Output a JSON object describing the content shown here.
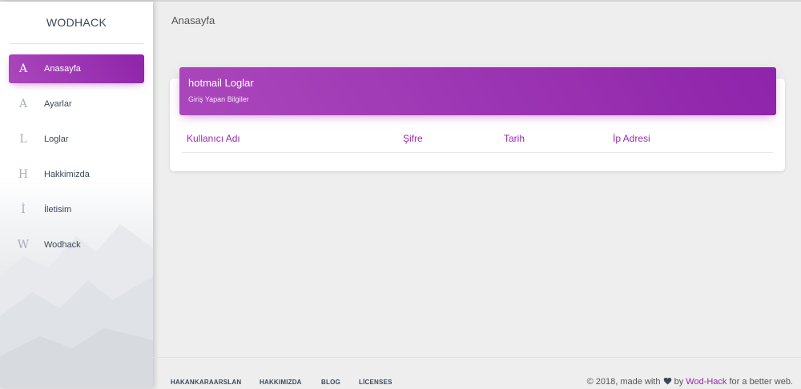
{
  "sidebar": {
    "brand": "WODHACK",
    "items": [
      {
        "letter": "A",
        "label": "Anasayfa",
        "active": true
      },
      {
        "letter": "A",
        "label": "Ayarlar"
      },
      {
        "letter": "L",
        "label": "Loglar"
      },
      {
        "letter": "H",
        "label": "Hakkimizda"
      },
      {
        "letter": "İ",
        "label": "İletisim"
      },
      {
        "letter": "W",
        "label": "Wodhack"
      }
    ]
  },
  "header": {
    "title": "Anasayfa"
  },
  "card": {
    "title": "hotmail Loglar",
    "subtitle": "Giriş Yapan Bilgiler",
    "columns": [
      "Kullanıcı Adı",
      "Şifre",
      "Tarih",
      "İp Adresi"
    ]
  },
  "footer": {
    "links": [
      "HAKANKARAARSLAN",
      "HAKKIMIZDA",
      "BLOG",
      "LİCENSES"
    ],
    "copyright_prefix": "© 2018, made with",
    "copyright_by": "by",
    "copyright_link": "Wod-Hack",
    "copyright_suffix": "for a better web."
  },
  "colors": {
    "accent": "#9c27b0",
    "accent_gradient_start": "#ab47bc",
    "accent_gradient_end": "#8e24aa"
  },
  "icons": {
    "heart": "heart-icon"
  }
}
